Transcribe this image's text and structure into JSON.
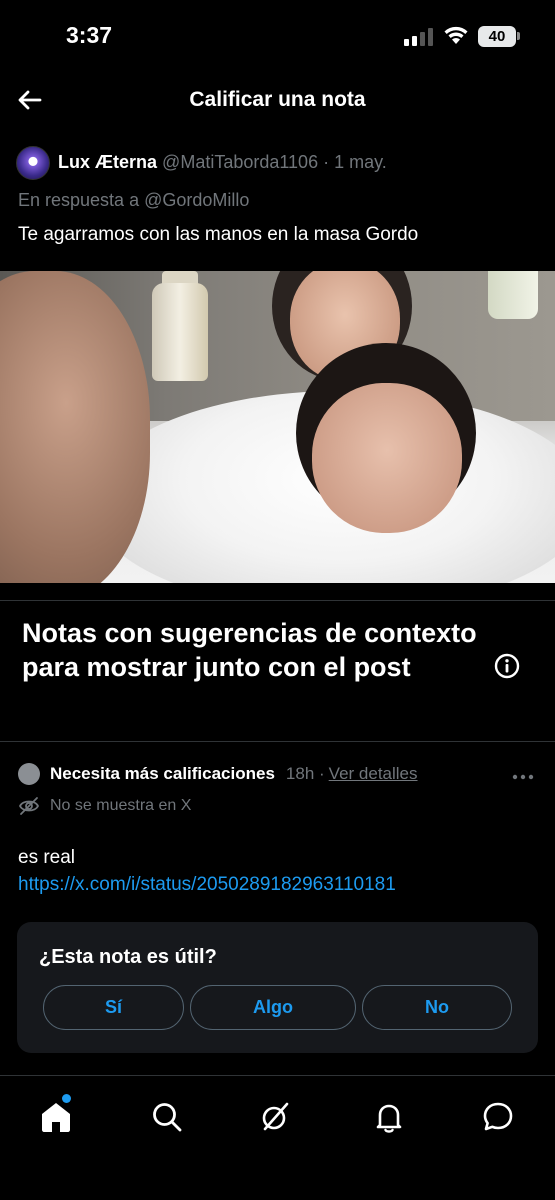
{
  "status_bar": {
    "time": "3:37",
    "battery": "40"
  },
  "header": {
    "title": "Calificar una nota"
  },
  "post": {
    "author_name": "Lux Æterna",
    "handle_date": "@MatiTaborda1106 · 1 may.",
    "reply_prefix": "En respuesta a",
    "reply_mention": "@GordoMillo",
    "text": "Te agarramos con las manos en la masa Gordo"
  },
  "section": {
    "title": "Notas con sugerencias de contexto para mostrar junto con el post"
  },
  "note": {
    "status_label": "Necesita más calificaciones",
    "time": "18h ·",
    "details_link": "Ver detalles",
    "visibility": "No se muestra en X",
    "text": "es real",
    "link": "https://x.com/i/status/2050289182963110181"
  },
  "rating": {
    "question": "¿Esta nota es útil?",
    "options": [
      "Sí",
      "Algo",
      "No"
    ]
  },
  "nav": {
    "items": [
      "home-icon",
      "search-icon",
      "grok-icon",
      "notifications-icon",
      "messages-icon"
    ]
  },
  "colors": {
    "background": "#000000",
    "accent": "#1d9bf0",
    "muted_text": "#71767b",
    "card": "#16181c",
    "divider": "#2f3336"
  }
}
